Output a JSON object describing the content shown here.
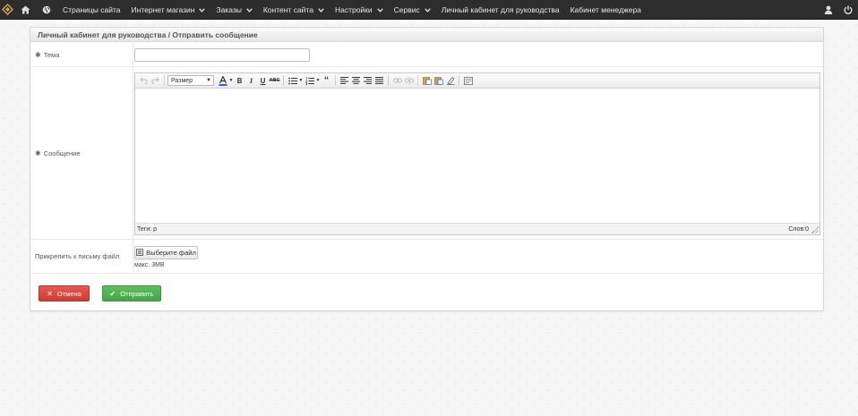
{
  "navbar": {
    "items": [
      {
        "label": "Страницы сайта",
        "dropdown": false
      },
      {
        "label": "Интернет магазин",
        "dropdown": true
      },
      {
        "label": "Заказы",
        "dropdown": true
      },
      {
        "label": "Контент сайта",
        "dropdown": true
      },
      {
        "label": "Настройки",
        "dropdown": true
      },
      {
        "label": "Сервис",
        "dropdown": true
      },
      {
        "label": "Личный кабинет для руководства",
        "dropdown": false
      },
      {
        "label": "Кабинет менеджера",
        "dropdown": false
      }
    ]
  },
  "panel": {
    "breadcrumb": "Личный кабинет для руководства / Отправить сообщение"
  },
  "form": {
    "subject_label": "Тема",
    "subject_value": "",
    "message_label": "Сообщение",
    "attach_label": "Прикрепить к письму файл",
    "file_button": "Выберите файл",
    "file_hint": "макс. 3MB",
    "cancel": "Отмена",
    "submit": "Отправить"
  },
  "editor": {
    "size_select": "Размер",
    "status_tags": "Теги: p",
    "status_words": "Слов:0"
  },
  "colors": {
    "navbar": "#2d2d2d",
    "cancel": "#d9433d",
    "submit": "#4cae4c"
  }
}
